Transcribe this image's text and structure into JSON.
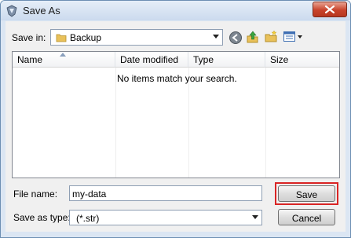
{
  "window": {
    "title": "Save As"
  },
  "toolbar": {
    "save_in_label": "Save in:",
    "location": "Backup",
    "icons": [
      "back-icon",
      "up-folder-icon",
      "new-folder-icon",
      "view-menu-icon"
    ]
  },
  "file_list": {
    "columns": [
      "Name",
      "Date modified",
      "Type",
      "Size"
    ],
    "empty_message": "No items match your search."
  },
  "footer": {
    "file_name_label": "File name:",
    "file_name_value": "my-data",
    "save_as_type_label": "Save as type:",
    "save_as_type_value": "(*.str)",
    "save_button": "Save",
    "cancel_button": "Cancel"
  },
  "colors": {
    "highlight": "#d92525",
    "titlebar": "#cbdaee"
  }
}
